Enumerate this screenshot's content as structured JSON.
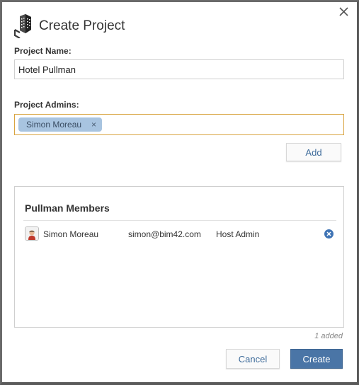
{
  "dialog": {
    "title": "Create Project",
    "close_icon": "close-icon",
    "logo_icon": "building-icon"
  },
  "project_name": {
    "label": "Project Name:",
    "value": "Hotel Pullman"
  },
  "project_admins": {
    "label": "Project Admins:",
    "chips": [
      {
        "label": "Simon Moreau",
        "remove_symbol": "×"
      }
    ],
    "add_label": "Add"
  },
  "members": {
    "title": "Pullman Members",
    "rows": [
      {
        "name": "Simon Moreau",
        "email": "simon@bim42.com",
        "role": "Host Admin",
        "remove_icon": "remove-circle-icon"
      }
    ],
    "added_count": "1 added"
  },
  "footer": {
    "cancel_label": "Cancel",
    "create_label": "Create"
  },
  "colors": {
    "accent": "#4a75a6",
    "chip": "#a8c4e0",
    "focus_border": "#d9a441",
    "remove_icon": "#3f74b5"
  }
}
